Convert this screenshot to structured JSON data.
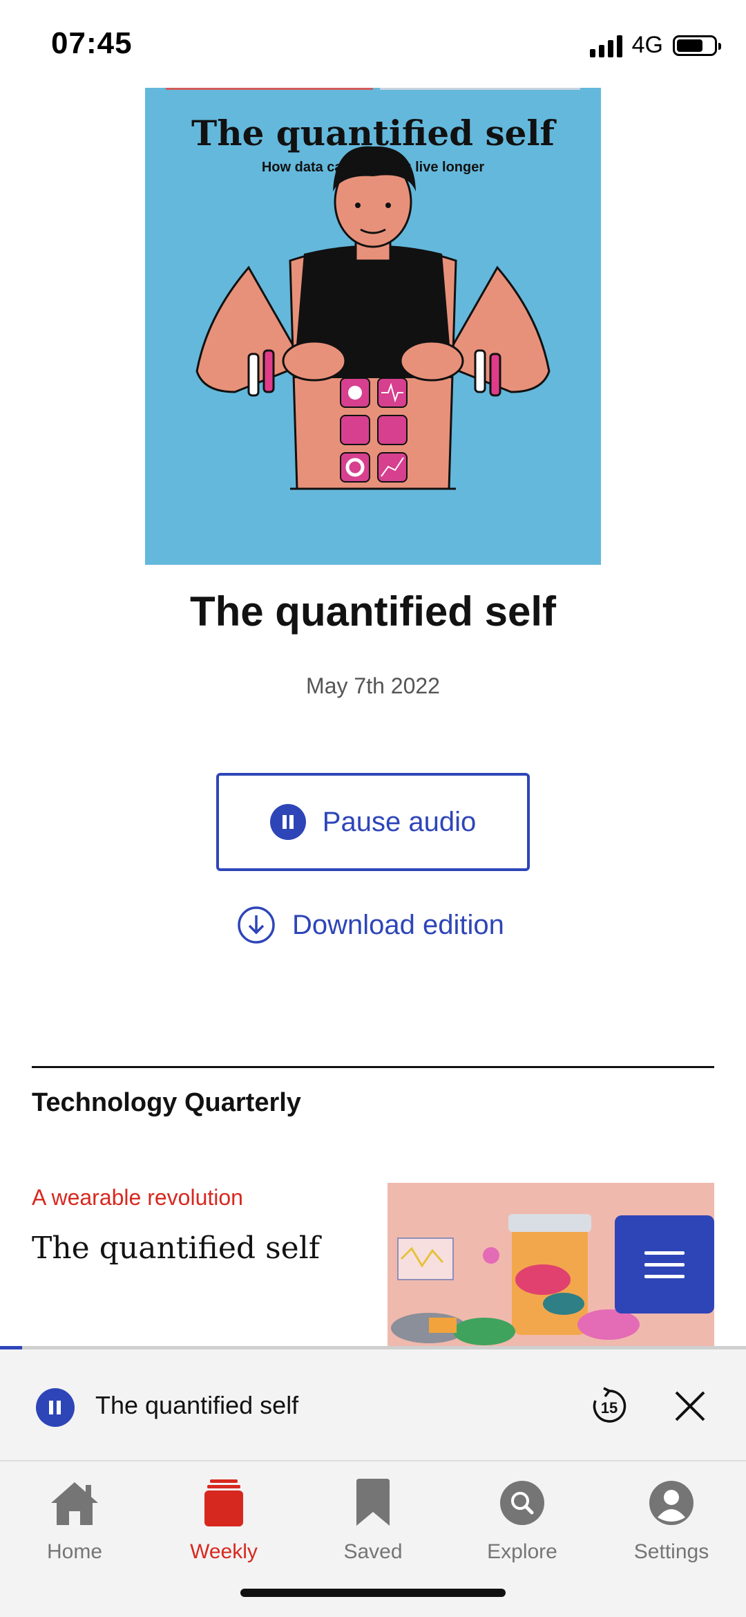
{
  "status_bar": {
    "time": "07:45",
    "network": "4G",
    "battery_level": 0.72
  },
  "cover": {
    "title": "The quantified self",
    "subtitle": "How data can help you live longer",
    "background_color": "#64b8db"
  },
  "edition": {
    "title": "The quantified self",
    "date": "May 7th 2022"
  },
  "actions": {
    "pause_label": "Pause audio",
    "download_label": "Download edition"
  },
  "section": {
    "title": "Technology Quarterly"
  },
  "article": {
    "rubric": "A wearable revolution",
    "headline": "The quantified self"
  },
  "player": {
    "title": "The quantified self",
    "progress": 0.03,
    "rewind_seconds": "15"
  },
  "tabs": [
    {
      "label": "Home",
      "icon": "home-icon",
      "active": false
    },
    {
      "label": "Weekly",
      "icon": "weekly-icon",
      "active": true
    },
    {
      "label": "Saved",
      "icon": "bookmark-icon",
      "active": false
    },
    {
      "label": "Explore",
      "icon": "search-icon",
      "active": false
    },
    {
      "label": "Settings",
      "icon": "user-icon",
      "active": false
    }
  ],
  "colors": {
    "accent": "#2e45b8",
    "brand_red": "#d7281f"
  }
}
